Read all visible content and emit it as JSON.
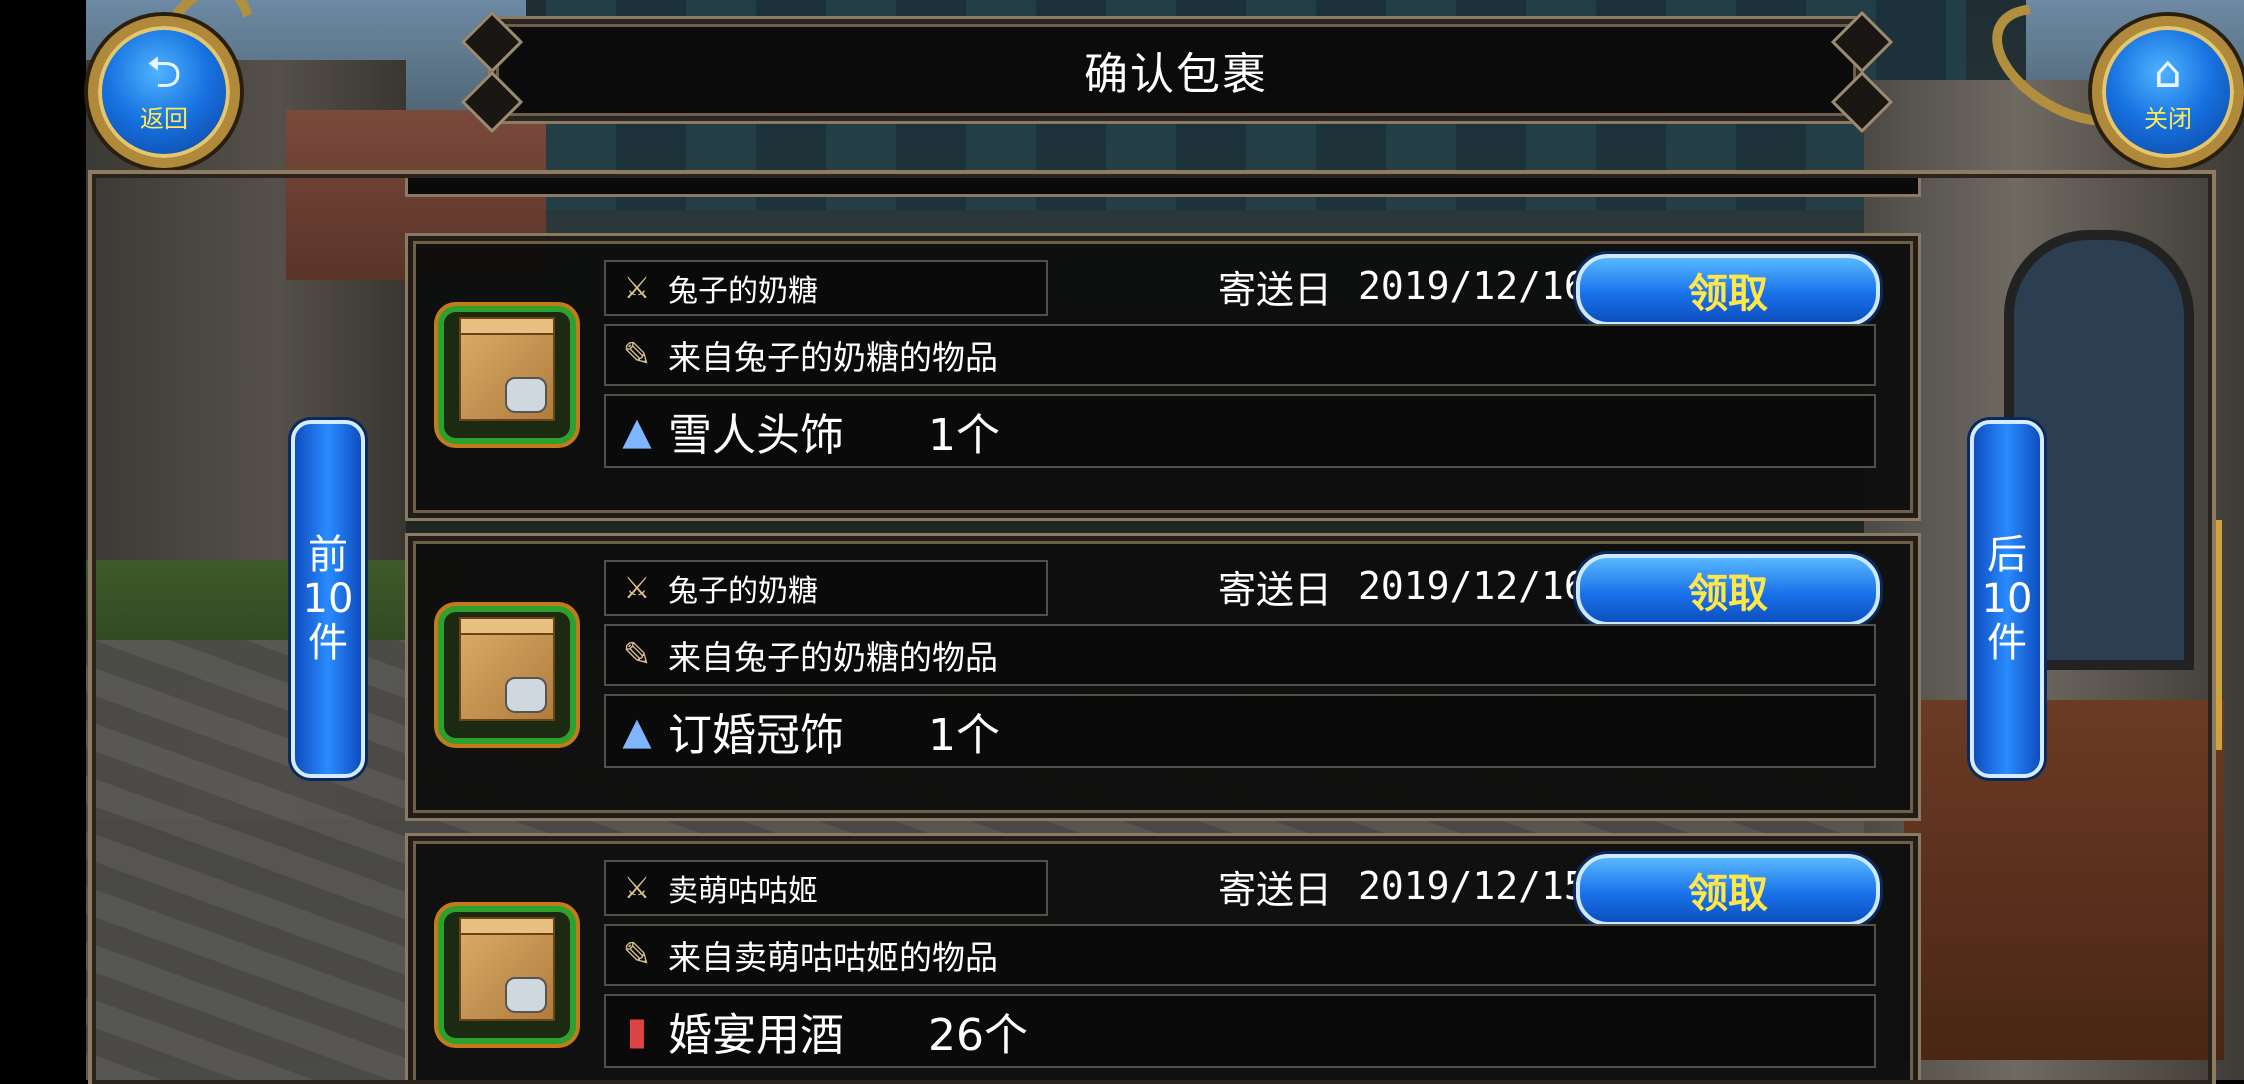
{
  "header": {
    "title": "确认包裹"
  },
  "nav": {
    "back_label": "返回",
    "close_label": "关闭",
    "prev_label_lines": [
      "前",
      "10",
      "件"
    ],
    "next_label_lines": [
      "后",
      "10",
      "件"
    ]
  },
  "labels": {
    "sent_date": "寄送日",
    "claim": "领取"
  },
  "parcels": [
    {
      "sender": "兔子的奶糖",
      "date": "2019/12/16",
      "description": "来自兔子的奶糖的物品",
      "item_name": "雪人头饰",
      "quantity": "1个",
      "item_icon": "hat-icon"
    },
    {
      "sender": "兔子的奶糖",
      "date": "2019/12/16",
      "description": "来自兔子的奶糖的物品",
      "item_name": "订婚冠饰",
      "quantity": "1个",
      "item_icon": "hat-icon"
    },
    {
      "sender": "卖萌咕咕姬",
      "date": "2019/12/15",
      "description": "来自卖萌咕咕姬的物品",
      "item_name": "婚宴用酒",
      "quantity": "26个",
      "item_icon": "wine-bottle-icon"
    }
  ],
  "colors": {
    "accent_blue": "#1a73ea",
    "claim_text": "#ffe74a",
    "frame_border": "#8b7a63",
    "icon_border_green": "#2ea02e"
  }
}
